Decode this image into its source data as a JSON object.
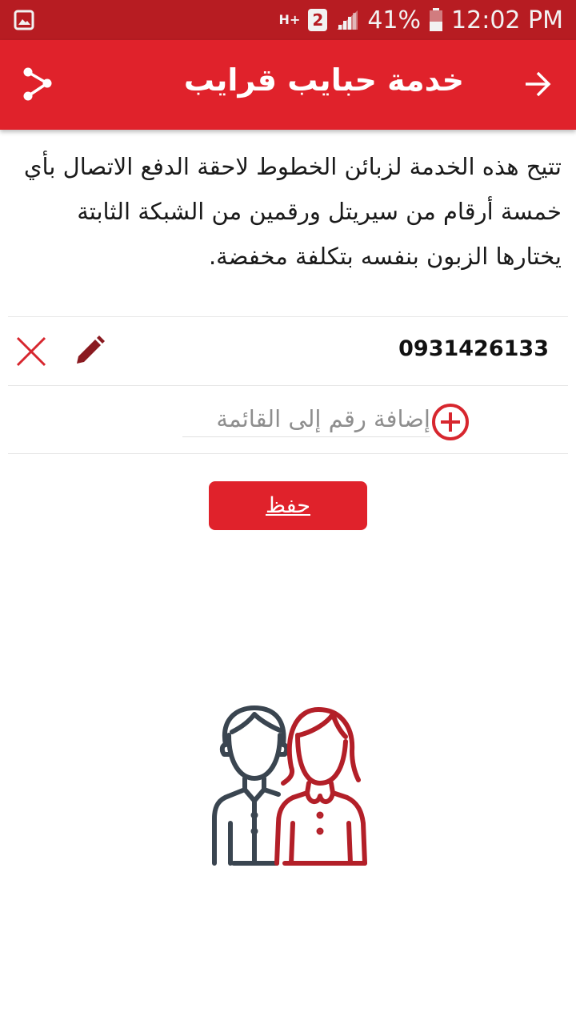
{
  "status_bar": {
    "network_type": "H+",
    "sim_slot": "2",
    "battery": "41%",
    "time": "12:02 PM"
  },
  "app_bar": {
    "title": "خدمة حبايب قرايب"
  },
  "description": "تتيح هذه الخدمة لزبائن الخطوط لاحقة الدفع الاتصال بأي خمسة أرقام من سيريتل ورقمين من الشبكة الثابتة يختارها الزبون بنفسه بتكلفة مخفضة.",
  "numbers": [
    {
      "value": "0931426133"
    }
  ],
  "add_number": {
    "placeholder": "إضافة رقم إلى القائمة",
    "value": ""
  },
  "save_label": "حفظ",
  "colors": {
    "status_bar": "#b71c22",
    "accent": "#e0222b",
    "man_figure": "#3a4550",
    "woman_figure": "#b31f28"
  },
  "icons": [
    "gallery-icon",
    "sim-icon",
    "signal-icon",
    "battery-icon",
    "share-icon",
    "back-arrow-icon",
    "edit-icon",
    "delete-icon",
    "add-circle-icon"
  ]
}
